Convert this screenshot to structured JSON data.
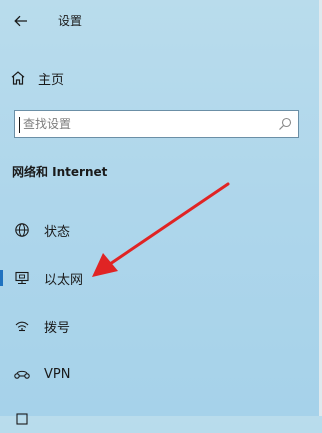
{
  "window": {
    "title": "设置"
  },
  "home": {
    "label": "主页"
  },
  "search": {
    "placeholder": "查找设置"
  },
  "section": {
    "title": "网络和 Internet"
  },
  "nav": {
    "items": [
      {
        "label": "状态",
        "icon": "globe-icon"
      },
      {
        "label": "以太网",
        "icon": "ethernet-icon"
      },
      {
        "label": "拨号",
        "icon": "dialup-icon"
      },
      {
        "label": "VPN",
        "icon": "vpn-icon"
      }
    ]
  },
  "annotation": {
    "color": "#e02424"
  },
  "colors": {
    "accent": "#1f72c0"
  }
}
